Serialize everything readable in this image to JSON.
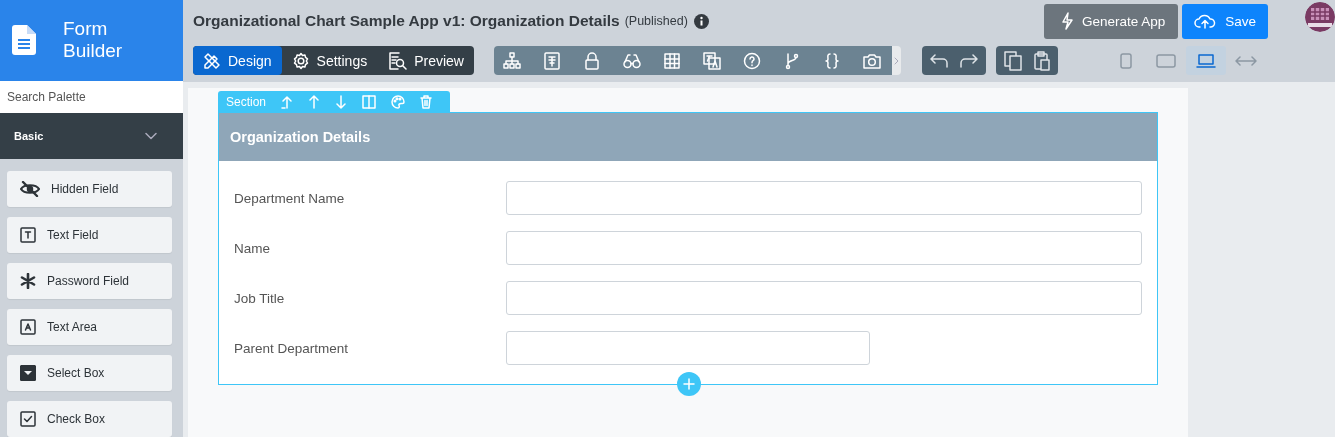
{
  "brand": {
    "line_1": "Form",
    "line_2": "Builder"
  },
  "palette": {
    "search_placeholder": "Search Palette",
    "group": {
      "label": "Basic",
      "expanded": true
    },
    "items": [
      {
        "label": "Hidden Field",
        "kind": "hidden"
      },
      {
        "label": "Text Field",
        "kind": "text"
      },
      {
        "label": "Password Field",
        "kind": "password"
      },
      {
        "label": "Text Area",
        "kind": "textarea"
      },
      {
        "label": "Select Box",
        "kind": "select"
      },
      {
        "label": "Check Box",
        "kind": "checkbox"
      }
    ]
  },
  "header": {
    "title": "Organizational Chart Sample App v1: Organization Details",
    "status": "(Published)",
    "generate_button": "Generate App",
    "save_button": "Save"
  },
  "tabs": [
    {
      "label": "Design",
      "kind": "design",
      "selected": true
    },
    {
      "label": "Settings",
      "kind": "settings",
      "selected": false
    },
    {
      "label": "Preview",
      "kind": "preview",
      "selected": false
    }
  ],
  "devices": [
    {
      "kind": "phone",
      "selected": false
    },
    {
      "kind": "tablet",
      "selected": false
    },
    {
      "kind": "laptop",
      "selected": true
    },
    {
      "kind": "wide",
      "selected": false
    }
  ],
  "section": {
    "tag": "Section",
    "title": "Organization Details",
    "fields": [
      {
        "label": "Department Name",
        "kind": "wide"
      },
      {
        "label": "Name",
        "kind": "wide"
      },
      {
        "label": "Job Title",
        "kind": "wide"
      },
      {
        "label": "Parent Department",
        "kind": "narrow"
      }
    ]
  }
}
